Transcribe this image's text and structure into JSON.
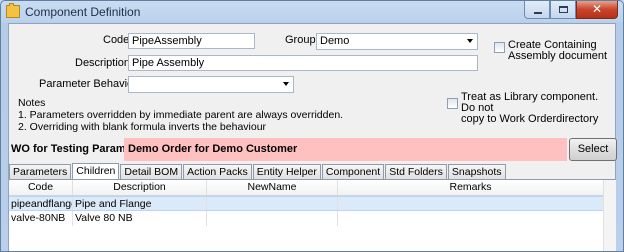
{
  "window": {
    "title": "Component Definition"
  },
  "form": {
    "code_label": "Code",
    "code_value": "PipeAssembly",
    "group_label": "Group",
    "group_value": "Demo",
    "description_label": "Description",
    "description_value": "Pipe Assembly",
    "create_containing_label_1": "Create Containing",
    "create_containing_label_2": "Assembly document",
    "create_containing_checked": false,
    "param_behaviour_label": "Parameter Behaviour",
    "param_behaviour_value": "",
    "treat_library_label_1": "Treat as Library component. Do not",
    "treat_library_label_2": "copy to Work Orderdirectory",
    "treat_library_checked": false,
    "notes": {
      "title": "Notes",
      "line1": "1. Parameters overridden by immediate parent are always overridden.",
      "line2": "2. Overriding with blank formula inverts the behaviour"
    }
  },
  "wo": {
    "label": "WO for Testing Parameters:",
    "value": "Demo Order for Demo Customer",
    "select_label": "Select",
    "highlight_color": "#ffc0c0"
  },
  "tabs": [
    "Parameters",
    "Children",
    "Detail BOM",
    "Action Packs",
    "Entity Helper",
    "Component",
    "Std Folders",
    "Snapshots"
  ],
  "active_tab": "Children",
  "grid": {
    "columns": [
      "Code",
      "Description",
      "NewName",
      "Remarks"
    ],
    "rows": [
      {
        "code": "pipeandflange",
        "description": "Pipe and Flange",
        "newname": "",
        "remarks": ""
      },
      {
        "code": "valve-80NB",
        "description": "Valve 80 NB",
        "newname": "",
        "remarks": ""
      }
    ]
  }
}
